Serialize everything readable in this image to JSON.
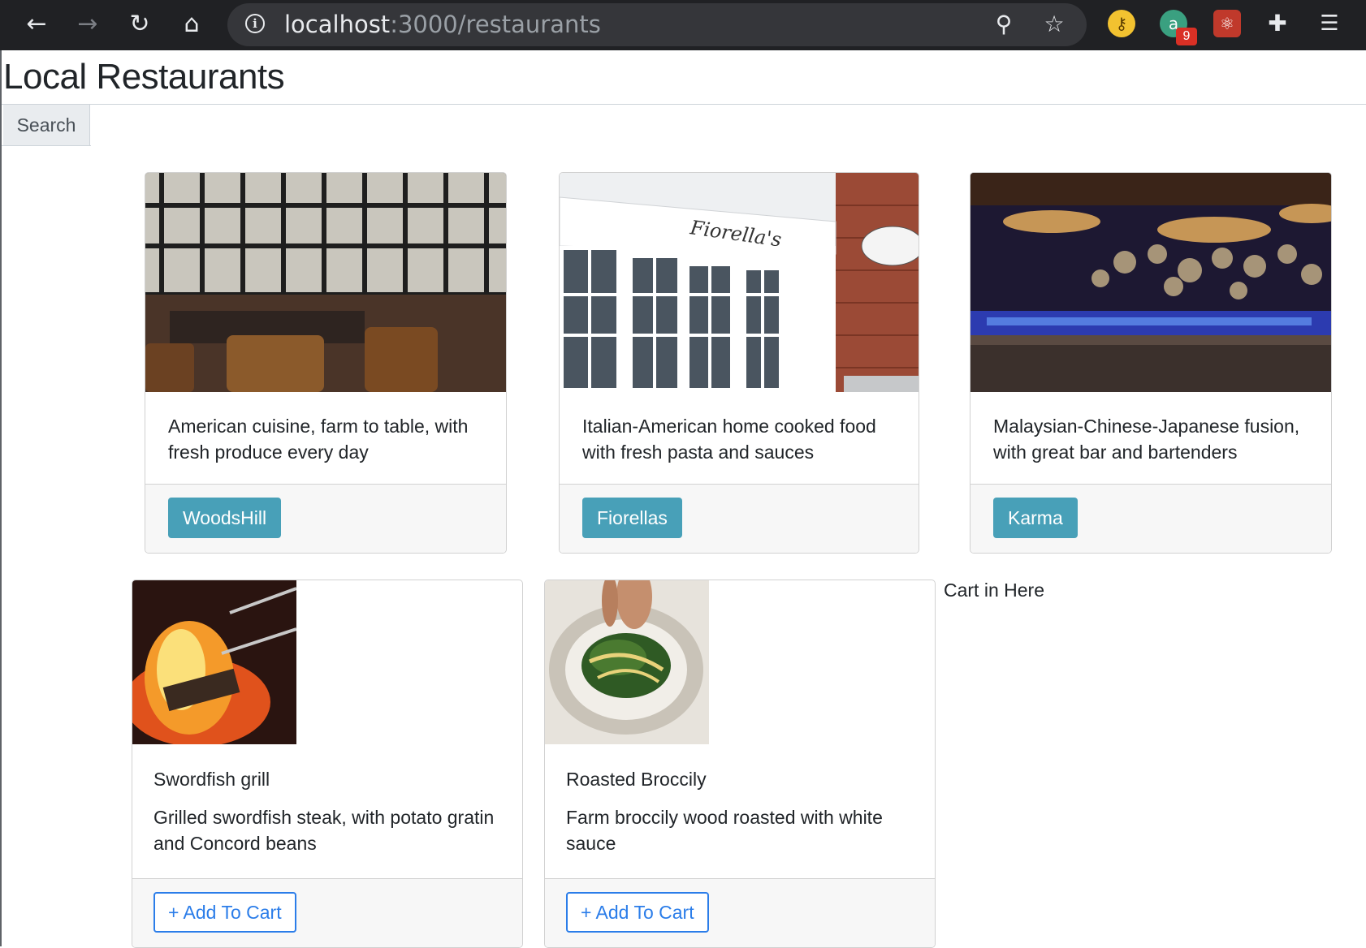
{
  "browser": {
    "url_host": "localhost",
    "url_path": ":3000/restaurants",
    "extension_badge": "9"
  },
  "page": {
    "title": "Local Restaurants",
    "search_label": "Search",
    "search_value": ""
  },
  "restaurants": [
    {
      "description": "American cuisine, farm to table, with fresh produce every day",
      "button": "WoodsHill"
    },
    {
      "description": "Italian-American home cooked food with fresh pasta and sauces",
      "button": "Fiorellas"
    },
    {
      "description": "Malaysian-Chinese-Japanese fusion, with great bar and bartenders",
      "button": "Karma"
    }
  ],
  "dishes": [
    {
      "name": "Swordfish grill",
      "description": "Grilled swordfish steak, with potato gratin and Concord beans",
      "button": "+ Add To Cart"
    },
    {
      "name": "Roasted Broccily",
      "description": "Farm broccily wood roasted with white sauce",
      "button": "+ Add To Cart"
    }
  ],
  "cart": {
    "label": "Cart in Here"
  },
  "colors": {
    "info_button": "#48a0b8",
    "outline_button": "#2b7de9",
    "chrome_bg": "#202124"
  },
  "icons": [
    "back-icon",
    "forward-icon",
    "reload-icon",
    "home-icon",
    "info-icon",
    "zoom-icon",
    "star-icon",
    "extensions-icon",
    "reading-list-icon"
  ]
}
